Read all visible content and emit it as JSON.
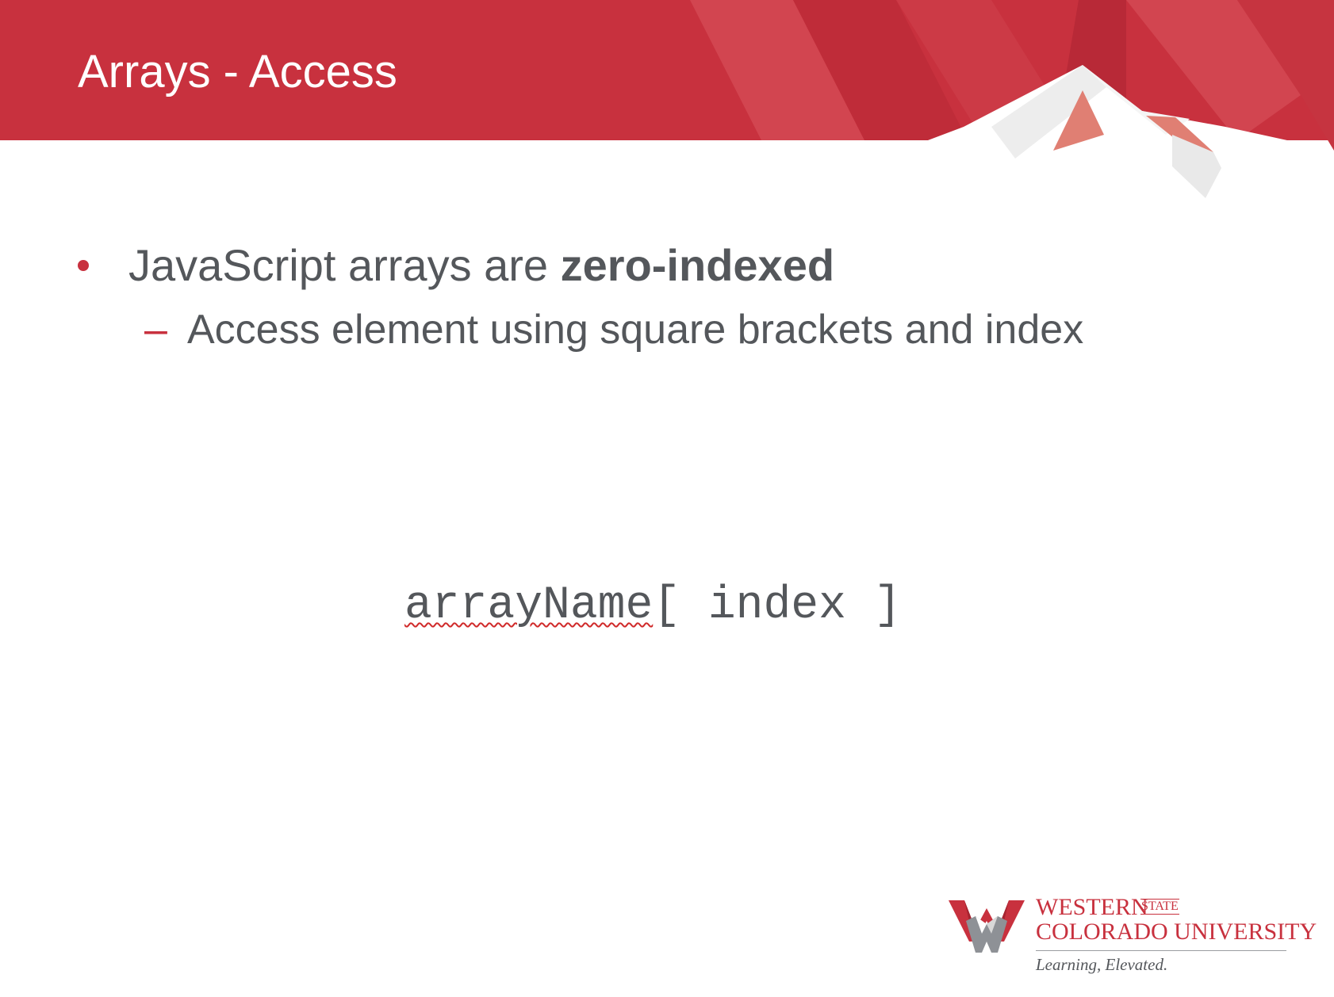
{
  "slide": {
    "title": "Arrays - Access",
    "bullets": [
      {
        "text_plain": "JavaScript arrays are ",
        "text_bold": "zero-indexed"
      }
    ],
    "sub_bullets": [
      {
        "text": "Access element using square brackets and index"
      }
    ],
    "code": {
      "name": "arrayName",
      "rest": "[ index ]"
    }
  },
  "logo": {
    "line1": "WESTERN",
    "state": "STATE",
    "line2": "COLORADO UNIVERSITY",
    "tagline": "Learning, Elevated."
  },
  "colors": {
    "brand_red": "#c8313e",
    "text_gray": "#54575b",
    "background": "#ffffff"
  }
}
